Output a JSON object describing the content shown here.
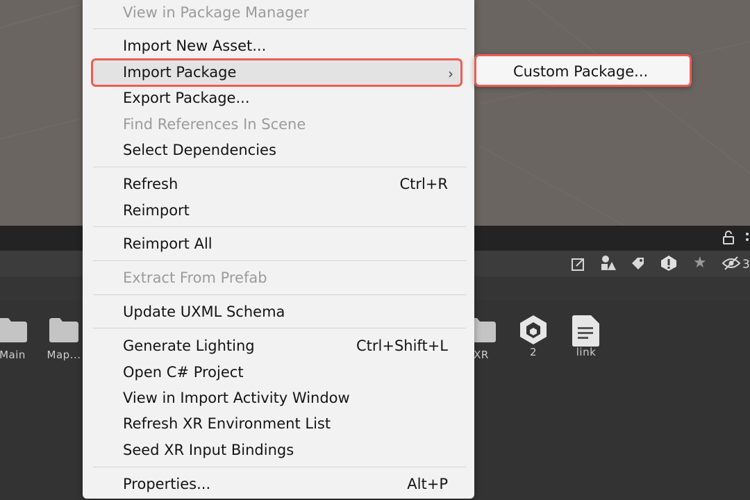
{
  "context_menu": {
    "items_top": [
      {
        "label": "View in Package Manager",
        "disabled": true
      },
      {
        "label": "Import New Asset...",
        "disabled": false
      },
      {
        "label": "Import Package",
        "disabled": false,
        "has_submenu": true
      },
      {
        "label": "Export Package...",
        "disabled": false
      },
      {
        "label": "Find References In Scene",
        "disabled": true
      },
      {
        "label": "Select Dependencies",
        "disabled": false
      }
    ],
    "refresh": {
      "label": "Refresh",
      "shortcut": "Ctrl+R"
    },
    "reimport": {
      "label": "Reimport"
    },
    "reimport_all": {
      "label": "Reimport All"
    },
    "extract_from_prefab": {
      "label": "Extract From Prefab",
      "disabled": true
    },
    "update_uxml": {
      "label": "Update UXML Schema"
    },
    "generate_lighting": {
      "label": "Generate Lighting",
      "shortcut": "Ctrl+Shift+L"
    },
    "open_csharp": {
      "label": "Open C# Project"
    },
    "view_import_activity": {
      "label": "View in Import Activity Window"
    },
    "refresh_xr": {
      "label": "Refresh XR Environment List"
    },
    "seed_xr": {
      "label": "Seed XR Input Bindings"
    },
    "properties": {
      "label": "Properties...",
      "shortcut": "Alt+P"
    }
  },
  "submenu": {
    "label": "Custom Package..."
  },
  "assets": [
    {
      "label": "Main",
      "icon": "folder-icon"
    },
    {
      "label": "Map...",
      "icon": "folder-icon"
    },
    {
      "label": "XR",
      "icon": "folder-icon"
    },
    {
      "label": "2",
      "icon": "unity-icon"
    },
    {
      "label": "link",
      "icon": "document-icon"
    }
  ],
  "toolbar": {
    "hidden_count": "3"
  },
  "colors": {
    "highlight": "#ee5c52",
    "menu_bg": "#f2f2f2",
    "scene_bg": "#6b6561"
  }
}
